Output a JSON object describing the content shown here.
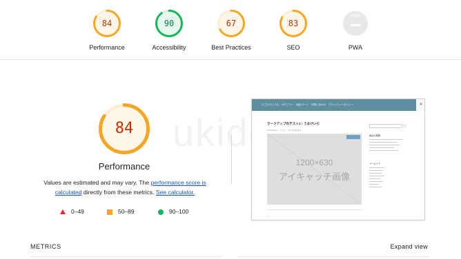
{
  "summary": [
    {
      "score": "84",
      "label": "Performance",
      "color": "#f5a623",
      "text_color": "#c33300",
      "fraction": 0.84
    },
    {
      "score": "90",
      "label": "Accessibility",
      "color": "#14b85a",
      "text_color": "#0b8043",
      "fraction": 0.9
    },
    {
      "score": "67",
      "label": "Best Practices",
      "color": "#f5a623",
      "text_color": "#c33300",
      "fraction": 0.67
    },
    {
      "score": "83",
      "label": "SEO",
      "color": "#f5a623",
      "text_color": "#c33300",
      "fraction": 0.83
    }
  ],
  "pwa": {
    "badge_text": "PWA",
    "label": "PWA",
    "icon": "dash-icon"
  },
  "watermark": "ukidoma",
  "main": {
    "score": "84",
    "title": "Performance",
    "fraction": 0.84,
    "desc_before": "Values are estimated and may vary. The ",
    "link_score": "performance score is calculated",
    "desc_middle": " directly from these metrics. ",
    "link_calc": "See calculator."
  },
  "legend": {
    "fail": "0–49",
    "average": "50–89",
    "pass": "90–100"
  },
  "screenshot": {
    "menu": "ロゴスサンプル　カテゴリー　固定ページ　お問い合わせ　プライバシーポリシー",
    "close": "✕",
    "post_title": "マークアップのテスト2｜うまけいら",
    "post_meta": "2020.04.01　テスト　2分で読めます",
    "image_line1": "1200×630",
    "image_line2": "アイキャッチ画像",
    "sidebar_heading": "最近の投稿",
    "sidebar_heading2": "アーカイブ",
    "footer": "ⓒ"
  },
  "metrics": {
    "title": "METRICS",
    "expand": "Expand view"
  }
}
